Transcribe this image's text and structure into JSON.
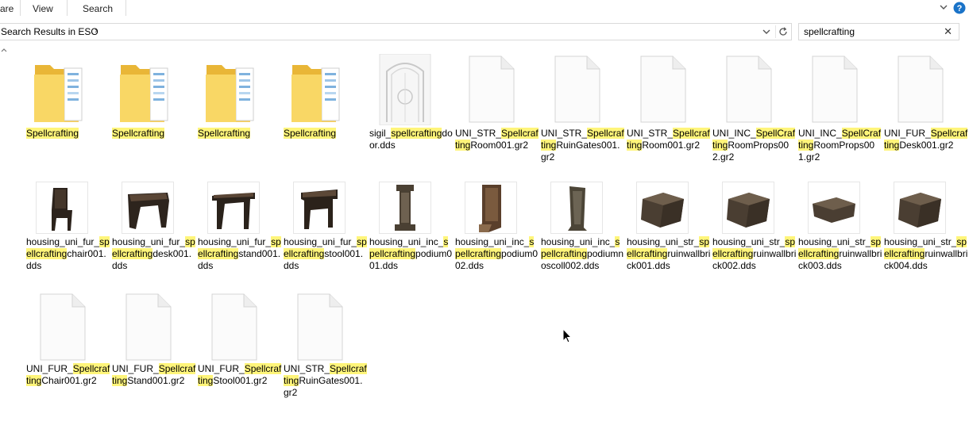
{
  "ribbon": {
    "tab_share": "are",
    "tab_view": "View",
    "tab_search": "Search"
  },
  "address": {
    "path": "Search Results in ESO"
  },
  "search": {
    "value": "spellcrafting"
  },
  "items": [
    {
      "type": "folder",
      "label_parts": [
        {
          "t": "Spellcrafting",
          "h": true
        }
      ]
    },
    {
      "type": "folder",
      "label_parts": [
        {
          "t": "Spellcrafting",
          "h": true
        }
      ]
    },
    {
      "type": "folder",
      "label_parts": [
        {
          "t": "Spellcrafting",
          "h": true
        }
      ]
    },
    {
      "type": "folder",
      "label_parts": [
        {
          "t": "Spellcrafting",
          "h": true
        }
      ]
    },
    {
      "type": "dds-door",
      "label_parts": [
        {
          "t": "sigil_",
          "h": false
        },
        {
          "t": "spellcrafting",
          "h": true
        },
        {
          "t": "door.dds",
          "h": false
        }
      ]
    },
    {
      "type": "file",
      "label_parts": [
        {
          "t": "UNI_STR_",
          "h": false
        },
        {
          "t": "Spellcra",
          "h": true
        },
        {
          "t": "fting",
          "h": true
        },
        {
          "t": "Room001.gr2",
          "h": false
        }
      ]
    },
    {
      "type": "file",
      "label_parts": [
        {
          "t": "UNI_STR_",
          "h": false
        },
        {
          "t": "Spellcra",
          "h": true
        },
        {
          "t": "fting",
          "h": true
        },
        {
          "t": "RuinGates001.gr2",
          "h": false
        }
      ]
    },
    {
      "type": "file",
      "label_parts": [
        {
          "t": "UNI_STR_",
          "h": false
        },
        {
          "t": "Spellcra",
          "h": true
        },
        {
          "t": "fting",
          "h": true
        },
        {
          "t": "Room001.gr2",
          "h": false
        }
      ]
    },
    {
      "type": "file",
      "label_parts": [
        {
          "t": "UNI_INC_",
          "h": false
        },
        {
          "t": "SpellCr",
          "h": true
        },
        {
          "t": "afting",
          "h": true
        },
        {
          "t": "RoomProps002.gr2",
          "h": false
        }
      ]
    },
    {
      "type": "file",
      "label_parts": [
        {
          "t": "UNI_INC_",
          "h": false
        },
        {
          "t": "SpellCr",
          "h": true
        },
        {
          "t": "afting",
          "h": true
        },
        {
          "t": "RoomProps001.gr2",
          "h": false
        }
      ]
    },
    {
      "type": "file",
      "label_parts": [
        {
          "t": "UNI_FUR_",
          "h": false
        },
        {
          "t": "Spellcr",
          "h": true
        },
        {
          "t": "afting",
          "h": true
        },
        {
          "t": "Desk001.gr2",
          "h": false
        }
      ]
    },
    {
      "type": "chair",
      "label_parts": [
        {
          "t": "housing_uni_fur_",
          "h": false
        },
        {
          "t": "spellcrafting",
          "h": true
        },
        {
          "t": "chair001.dds",
          "h": false
        }
      ]
    },
    {
      "type": "desk",
      "label_parts": [
        {
          "t": "housing_uni_fur_",
          "h": false
        },
        {
          "t": "spellcrafting",
          "h": true
        },
        {
          "t": "desk001.dds",
          "h": false
        }
      ]
    },
    {
      "type": "stand",
      "label_parts": [
        {
          "t": "housing_uni_fur_",
          "h": false
        },
        {
          "t": "spellcrafting",
          "h": true
        },
        {
          "t": "stand001.dds",
          "h": false
        }
      ]
    },
    {
      "type": "stool",
      "label_parts": [
        {
          "t": "housing_uni_fur_",
          "h": false
        },
        {
          "t": "spellcrafting",
          "h": true
        },
        {
          "t": "stool001.dds",
          "h": false
        }
      ]
    },
    {
      "type": "podium",
      "label_parts": [
        {
          "t": "housing_uni_inc_",
          "h": false
        },
        {
          "t": "spellcrafting",
          "h": true
        },
        {
          "t": "podium001.dds",
          "h": false
        }
      ]
    },
    {
      "type": "podium2",
      "label_parts": [
        {
          "t": "housing_uni_inc_",
          "h": false
        },
        {
          "t": "spellcrafting",
          "h": true
        },
        {
          "t": "podium002.dds",
          "h": false
        }
      ]
    },
    {
      "type": "podium3",
      "label_parts": [
        {
          "t": "housing_uni_inc_",
          "h": false
        },
        {
          "t": "spellcrafting",
          "h": true
        },
        {
          "t": "podiumnoscoll002.dds",
          "h": false
        }
      ]
    },
    {
      "type": "brick",
      "label_parts": [
        {
          "t": "housing_uni_str_",
          "h": false
        },
        {
          "t": "spellcrafting",
          "h": true
        },
        {
          "t": "ruinwallbrick001.dds",
          "h": false
        }
      ]
    },
    {
      "type": "brick",
      "label_parts": [
        {
          "t": "housing_uni_str_",
          "h": false
        },
        {
          "t": "spellcrafting",
          "h": true
        },
        {
          "t": "ruinwallbrick002.dds",
          "h": false
        }
      ]
    },
    {
      "type": "brick-flat",
      "label_parts": [
        {
          "t": "housing_uni_str_",
          "h": false
        },
        {
          "t": "spellcrafting",
          "h": true
        },
        {
          "t": "ruinwallbrick003.dds",
          "h": false
        }
      ]
    },
    {
      "type": "brick",
      "label_parts": [
        {
          "t": "housing_uni_str_",
          "h": false
        },
        {
          "t": "spellcrafting",
          "h": true
        },
        {
          "t": "ruinwallbrick004.dds",
          "h": false
        }
      ]
    },
    {
      "type": "file",
      "label_parts": [
        {
          "t": "UNI_FUR_",
          "h": false
        },
        {
          "t": "Spellcr",
          "h": true
        },
        {
          "t": "afting",
          "h": true
        },
        {
          "t": "Chair001.gr2",
          "h": false
        }
      ]
    },
    {
      "type": "file",
      "label_parts": [
        {
          "t": "UNI_FUR_",
          "h": false
        },
        {
          "t": "Spellcr",
          "h": true
        },
        {
          "t": "afting",
          "h": true
        },
        {
          "t": "Stand001.gr2",
          "h": false
        }
      ]
    },
    {
      "type": "file",
      "label_parts": [
        {
          "t": "UNI_FUR_",
          "h": false
        },
        {
          "t": "Spellcr",
          "h": true
        },
        {
          "t": "afting",
          "h": true
        },
        {
          "t": "Stool001.gr2",
          "h": false
        }
      ]
    },
    {
      "type": "file",
      "label_parts": [
        {
          "t": "UNI_STR_",
          "h": false
        },
        {
          "t": "Spellcra",
          "h": true
        },
        {
          "t": "fting",
          "h": true
        },
        {
          "t": "RuinGates001.gr2",
          "h": false
        }
      ]
    }
  ],
  "colors": {
    "highlight": "#fff57a",
    "folder": "#f5c94c",
    "help": "#1a73c8"
  }
}
